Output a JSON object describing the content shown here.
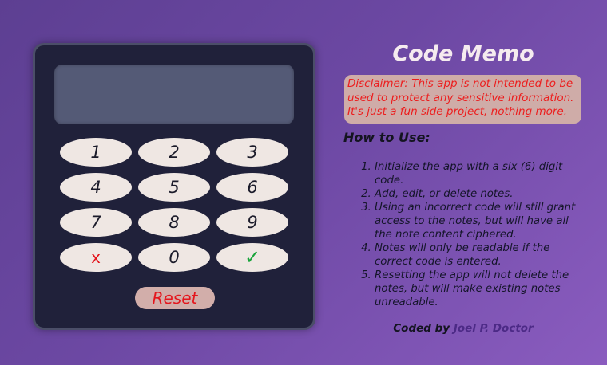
{
  "keypad": {
    "keys": [
      {
        "label": "1"
      },
      {
        "label": "2"
      },
      {
        "label": "3"
      },
      {
        "label": "4"
      },
      {
        "label": "5"
      },
      {
        "label": "6"
      },
      {
        "label": "7"
      },
      {
        "label": "8"
      },
      {
        "label": "9"
      },
      {
        "label": "x"
      },
      {
        "label": "0"
      },
      {
        "label": "✓"
      }
    ],
    "reset_label": "Reset",
    "display_value": ""
  },
  "panel": {
    "title": "Code Memo",
    "disclaimer": "Disclaimer: This app is not intended to be used to protect any sensitive information. It's just a fun side project, nothing more.",
    "how_to_title": "How to Use:",
    "steps": [
      "Initialize the app with a six (6) digit code.",
      "Add, edit, or delete notes.",
      "Using an incorrect code will still grant access to the notes, but will have all the note content ciphered.",
      "Notes will only be readable if the correct code is entered.",
      "Resetting the app will not delete the notes, but will make existing notes unreadable."
    ],
    "credit_prefix": "Coded by",
    "credit_author": "Joel P. Doctor"
  },
  "colors": {
    "background": "#6c48a3",
    "device": "#20213a",
    "screen": "#545a76",
    "key": "#efe7e3",
    "danger": "#e4161d",
    "success": "#18a43a",
    "disclaimer_bg": "#cfaca8",
    "author": "#4c2a86"
  }
}
